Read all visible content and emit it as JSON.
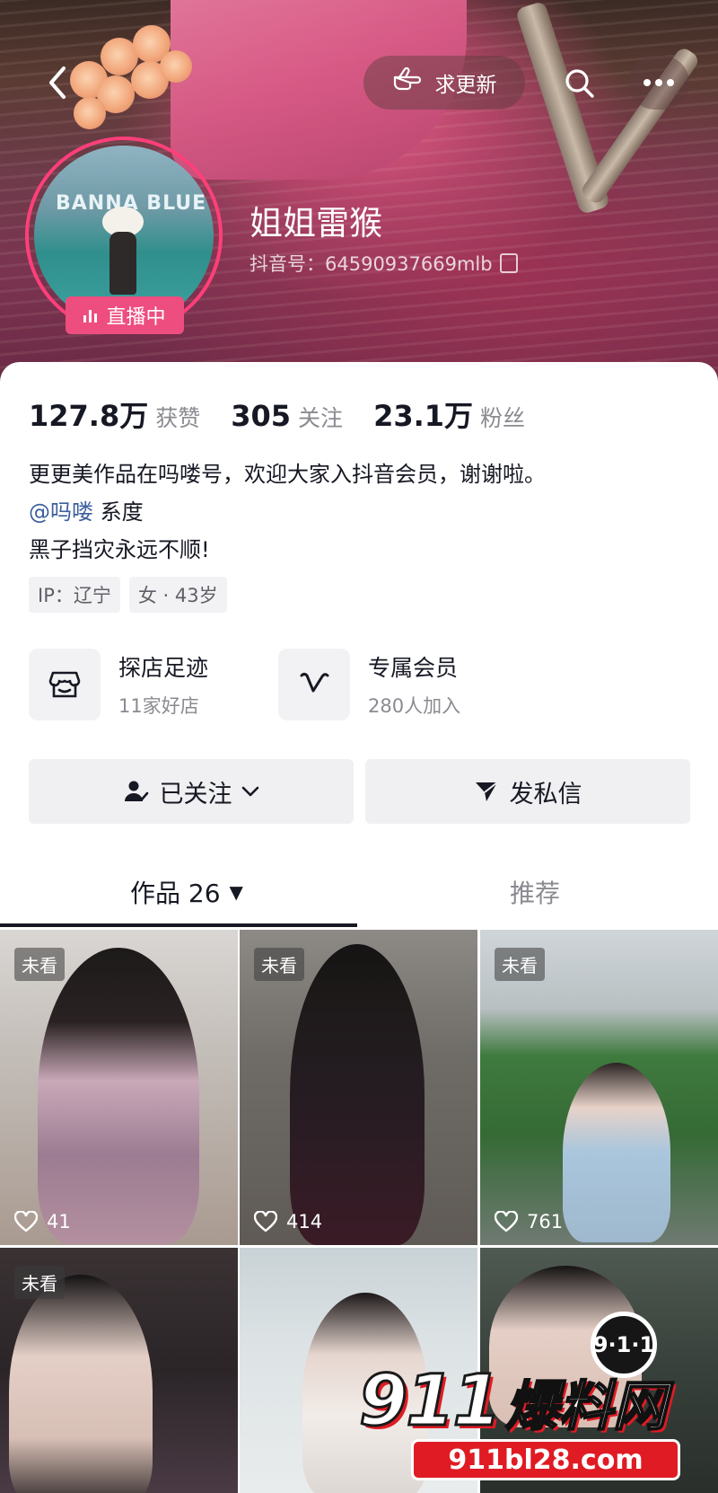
{
  "header": {
    "request_update_label": "求更新",
    "live_label": "直播中",
    "nickname": "姐姐雷猴",
    "douyin_id": "抖音号：64590937669mlb",
    "avatar_text": "BANNA BLUE"
  },
  "stats": [
    {
      "value": "127.8万",
      "label": "获赞"
    },
    {
      "value": "305",
      "label": "关注"
    },
    {
      "value": "23.1万",
      "label": "粉丝"
    }
  ],
  "bio": {
    "line1": "更更美作品在吗喽号，欢迎大家入抖音会员，谢谢啦。",
    "mention": "@吗喽",
    "mention_suffix": " 系度",
    "line3": "黑子挡灾永远不顺!"
  },
  "tags": [
    "IP：辽宁",
    "女 · 43岁"
  ],
  "features": [
    {
      "title": "探店足迹",
      "subtitle": "11家好店",
      "icon": "shop-icon"
    },
    {
      "title": "专属会员",
      "subtitle": "280人加入",
      "icon": "v-member-icon"
    }
  ],
  "actions": {
    "follow_label": "已关注",
    "message_label": "发私信"
  },
  "tabs": {
    "works_label": "作品 26",
    "recommend_label": "推荐"
  },
  "videos": [
    {
      "badge": "未看",
      "likes": "41"
    },
    {
      "badge": "未看",
      "likes": "414"
    },
    {
      "badge": "未看",
      "likes": "761"
    },
    {
      "badge": "未看",
      "likes": ""
    },
    {
      "badge": "",
      "likes": ""
    },
    {
      "badge": "",
      "likes": ""
    }
  ],
  "watermark": {
    "circle_text": "9·1·1",
    "brand_num": "911",
    "brand_cn": "爆料网",
    "url": "911bl28.com"
  },
  "colors": {
    "accent_pink": "#ee4d80",
    "mention_blue": "#3c5e9d",
    "watermark_red": "#e01b24"
  }
}
